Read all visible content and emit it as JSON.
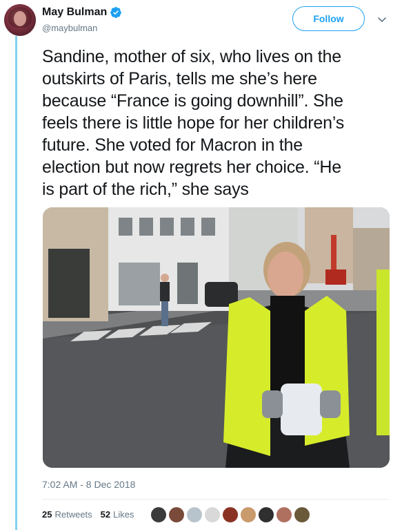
{
  "user": {
    "display_name": "May Bulman",
    "handle": "@maybulman",
    "verified": true,
    "avatar_icon": "profile-avatar"
  },
  "actions": {
    "follow_label": "Follow",
    "more_icon": "chevron-down-icon"
  },
  "tweet": {
    "text_lines": [
      "Sandine, mother of six, who lives on the",
      "outskirts of Paris, tells me she’s here",
      "because “France is going downhill”. She",
      "feels there is little hope for her children’s",
      "future. She voted for Macron in the",
      "election but now regrets her choice. “He",
      "is part of the rich,” she says"
    ],
    "timestamp": "7:02 AM - 8 Dec 2018"
  },
  "stats": {
    "retweets_count": "25",
    "retweets_label": "Retweets",
    "likes_count": "52",
    "likes_label": "Likes"
  },
  "likers": [
    {
      "color": "#3b3b3b"
    },
    {
      "color": "#7a4b3a"
    },
    {
      "color": "#b8c4cc"
    },
    {
      "color": "#d9d9d9"
    },
    {
      "color": "#8a3324"
    },
    {
      "color": "#c99a6b"
    },
    {
      "color": "#2f2f2f"
    },
    {
      "color": "#b07060"
    },
    {
      "color": "#6a5a3a"
    }
  ],
  "colors": {
    "accent": "#1da1f2",
    "thread_line": "#83d1ec",
    "secondary_text": "#657786"
  }
}
